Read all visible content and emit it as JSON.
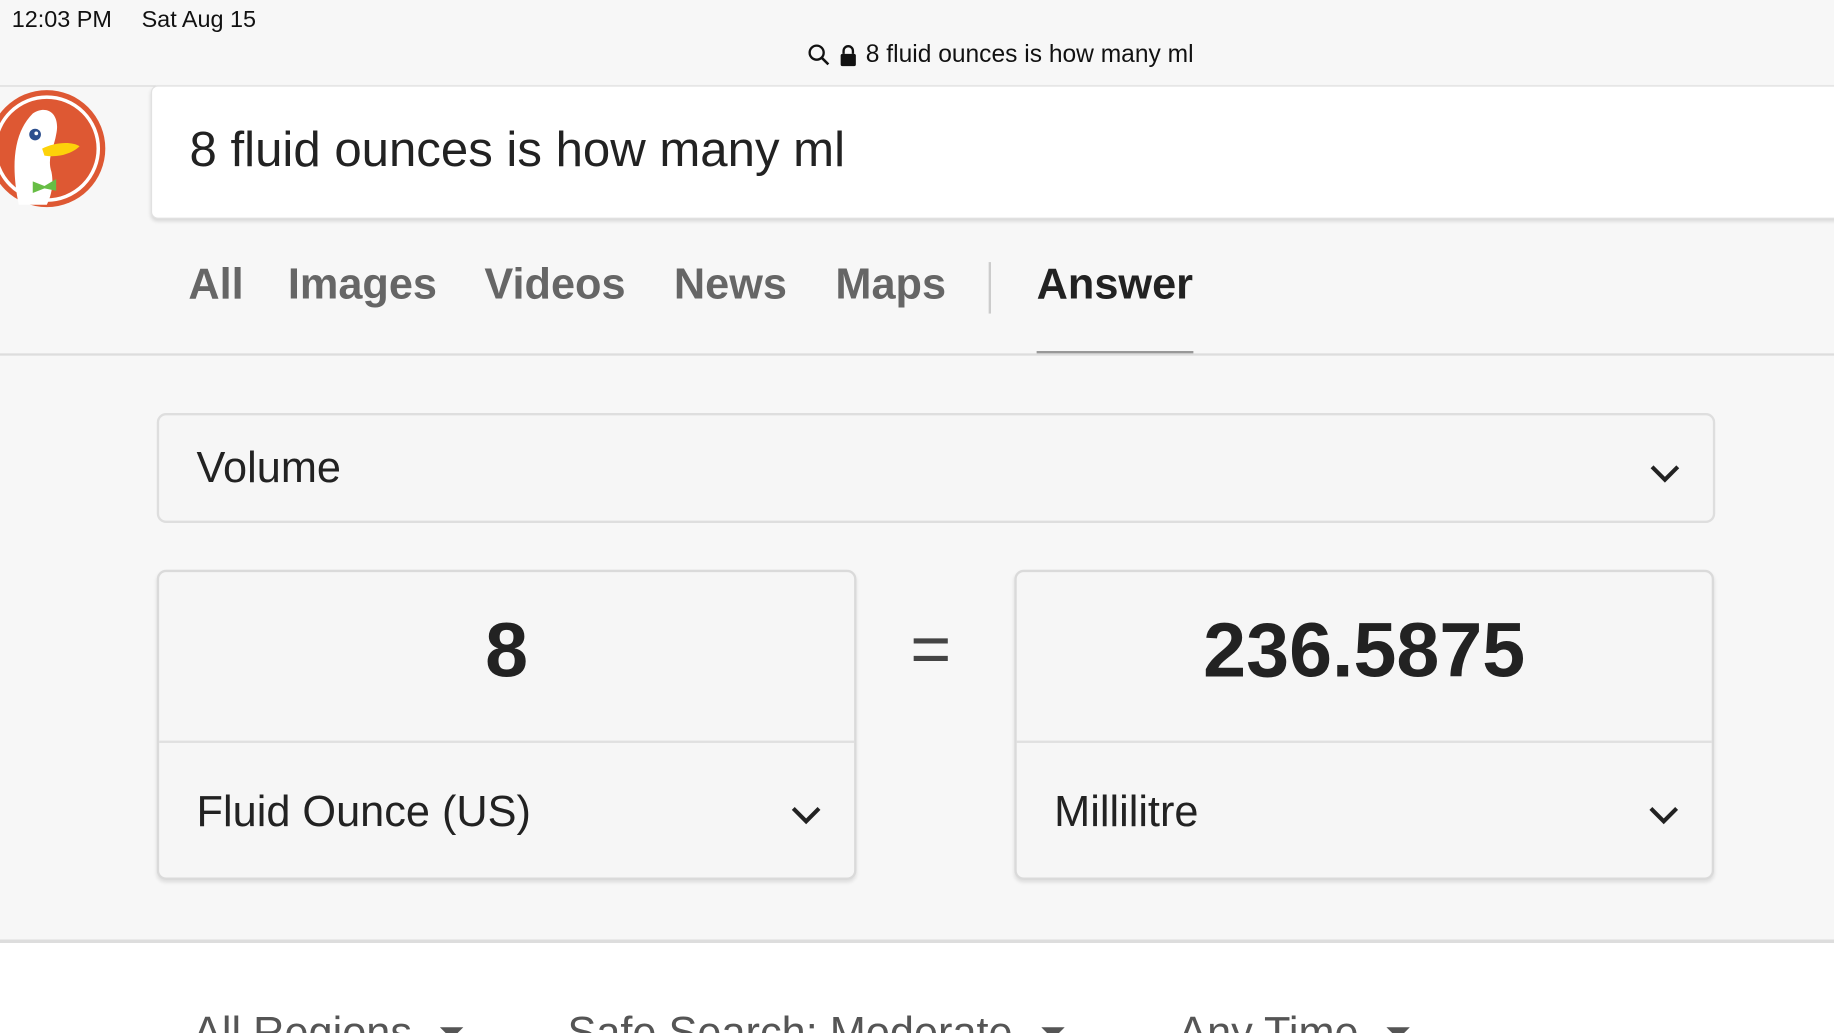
{
  "status": {
    "time": "12:03 PM",
    "date": "Sat Aug 15"
  },
  "address_bar": {
    "text": "8 fluid ounces is how many ml"
  },
  "search": {
    "query": "8 fluid ounces is how many ml"
  },
  "tabs": [
    {
      "label": "All"
    },
    {
      "label": "Images"
    },
    {
      "label": "Videos"
    },
    {
      "label": "News"
    },
    {
      "label": "Maps"
    },
    {
      "label": "Answer"
    }
  ],
  "converter": {
    "category": "Volume",
    "from": {
      "value": "8",
      "unit": "Fluid Ounce (US)"
    },
    "equals": "=",
    "to": {
      "value": "236.5875",
      "unit": "Millilitre"
    }
  },
  "filters": {
    "region": "All Regions",
    "safe_search": "Safe Search: Moderate",
    "time": "Any Time"
  },
  "colors": {
    "logo": "#de5833",
    "tab_active": "#222222",
    "tab_inactive": "#666666"
  }
}
